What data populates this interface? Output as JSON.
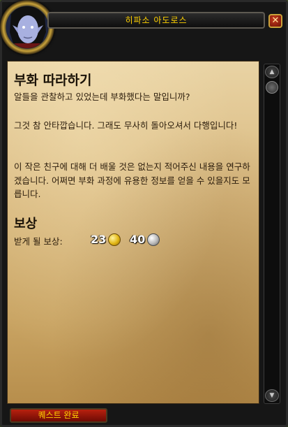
{
  "window": {
    "npc_name": "히파소 아도로스",
    "close_label": "✕"
  },
  "quest": {
    "title": "부화 따라하기",
    "paragraphs": [
      "알들을 관찰하고 있었는데 부화했다는 말입니까?",
      "그것 참 안타깝습니다. 그래도 무사히 돌아오셔서 다행입니다!",
      "이 작은 친구에 대해 더 배울 것은 없는지 적어주신 내용을 연구하겠습니다. 어쩌면 부화 과정에 유용한 정보를 얻을 수 있을지도 모릅니다."
    ]
  },
  "rewards": {
    "heading": "보상",
    "label": "받게 될 보상:",
    "gold": "23",
    "silver": "40"
  },
  "footer": {
    "complete_button": "퀘스트 완료"
  },
  "scrollbar": {
    "up_arrow": "▲",
    "down_arrow": "▼"
  },
  "icons": {
    "portrait": "npc-portrait-icon",
    "gold": "gold-coin-icon",
    "silver": "silver-coin-icon"
  }
}
